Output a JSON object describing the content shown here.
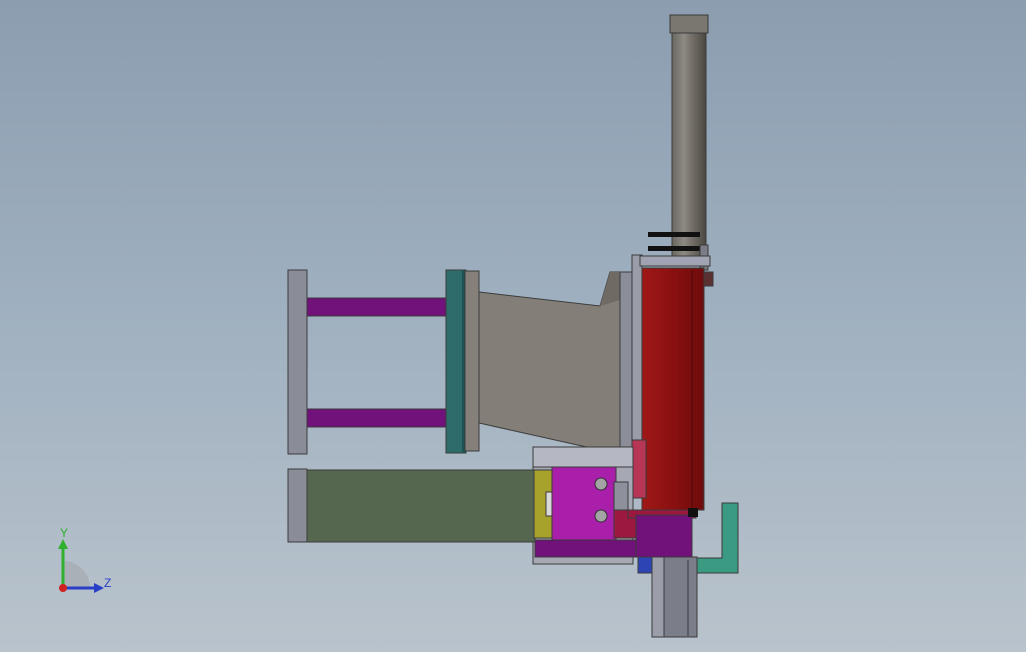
{
  "viewport": {
    "colors": {
      "background_top": "#8c9db0",
      "background_bottom": "#b9c3cc"
    }
  },
  "triad": {
    "y_label": "Y",
    "z_label": "Z",
    "colors": {
      "y_axis": "#2fb02f",
      "z_axis": "#2a3fc8",
      "x_axis": "#d02020"
    }
  }
}
